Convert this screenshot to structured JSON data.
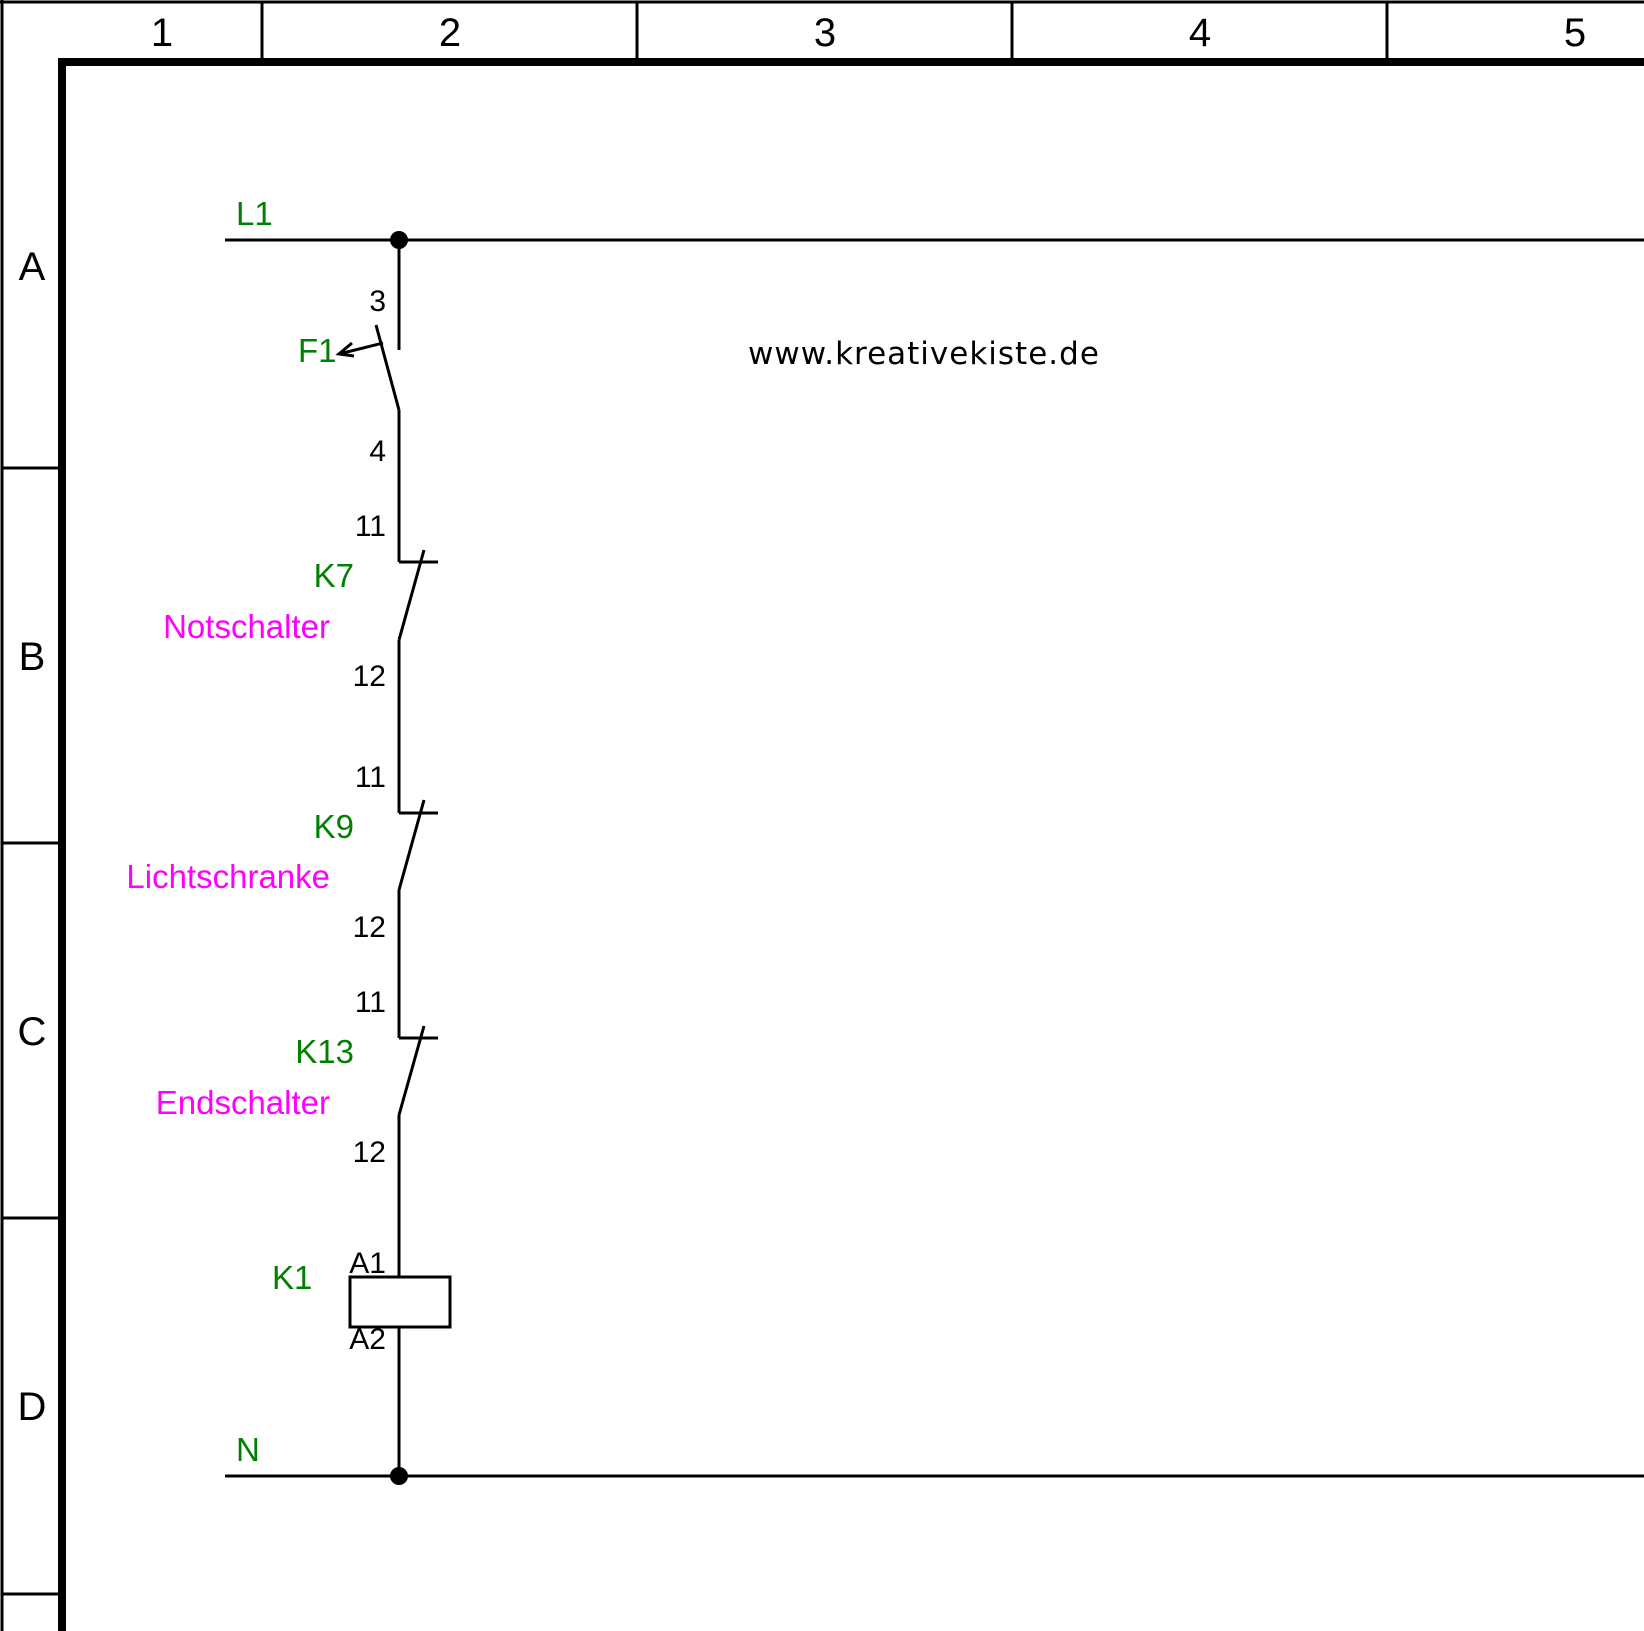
{
  "colors": {
    "line": "#000000",
    "tag": "#008000",
    "description": "#ff00ff",
    "background": "#ffffff"
  },
  "columns": [
    "1",
    "2",
    "3",
    "4",
    "5"
  ],
  "rows": [
    "A",
    "B",
    "C",
    "D"
  ],
  "watermark": "www.kreativekiste.de",
  "rails": {
    "top": "L1",
    "bottom": "N"
  },
  "devices": {
    "f1": {
      "tag": "F1",
      "term_top": "3",
      "term_bottom": "4"
    },
    "k7": {
      "tag": "K7",
      "description": "Notschalter",
      "term_top": "11",
      "term_bottom": "12"
    },
    "k9": {
      "tag": "K9",
      "description": "Lichtschranke",
      "term_top": "11",
      "term_bottom": "12"
    },
    "k13": {
      "tag": "K13",
      "description": "Endschalter",
      "term_top": "11",
      "term_bottom": "12"
    },
    "k1": {
      "tag": "K1",
      "term_top": "A1",
      "term_bottom": "A2"
    }
  }
}
